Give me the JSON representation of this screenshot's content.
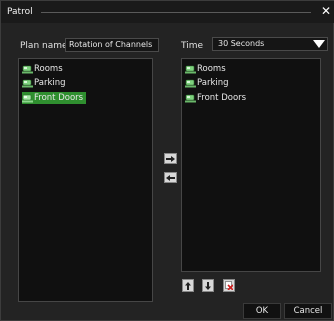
{
  "window": {
    "title": "Patrol"
  },
  "form": {
    "plan_name_label": "Plan name",
    "plan_name_value": "Rotation of Channels",
    "time_label": "Time",
    "time_value": "30 Seconds"
  },
  "left_list": {
    "items": [
      {
        "label": "Rooms",
        "selected": false
      },
      {
        "label": "Parking",
        "selected": false
      },
      {
        "label": "Front Doors",
        "selected": true
      }
    ]
  },
  "right_list": {
    "items": [
      {
        "label": "Rooms"
      },
      {
        "label": "Parking"
      },
      {
        "label": "Front Doors"
      }
    ]
  },
  "buttons": {
    "ok": "OK",
    "cancel": "Cancel"
  },
  "colors": {
    "selection": "#2f8f2f",
    "background": "#232323",
    "list_bg": "#101010"
  }
}
